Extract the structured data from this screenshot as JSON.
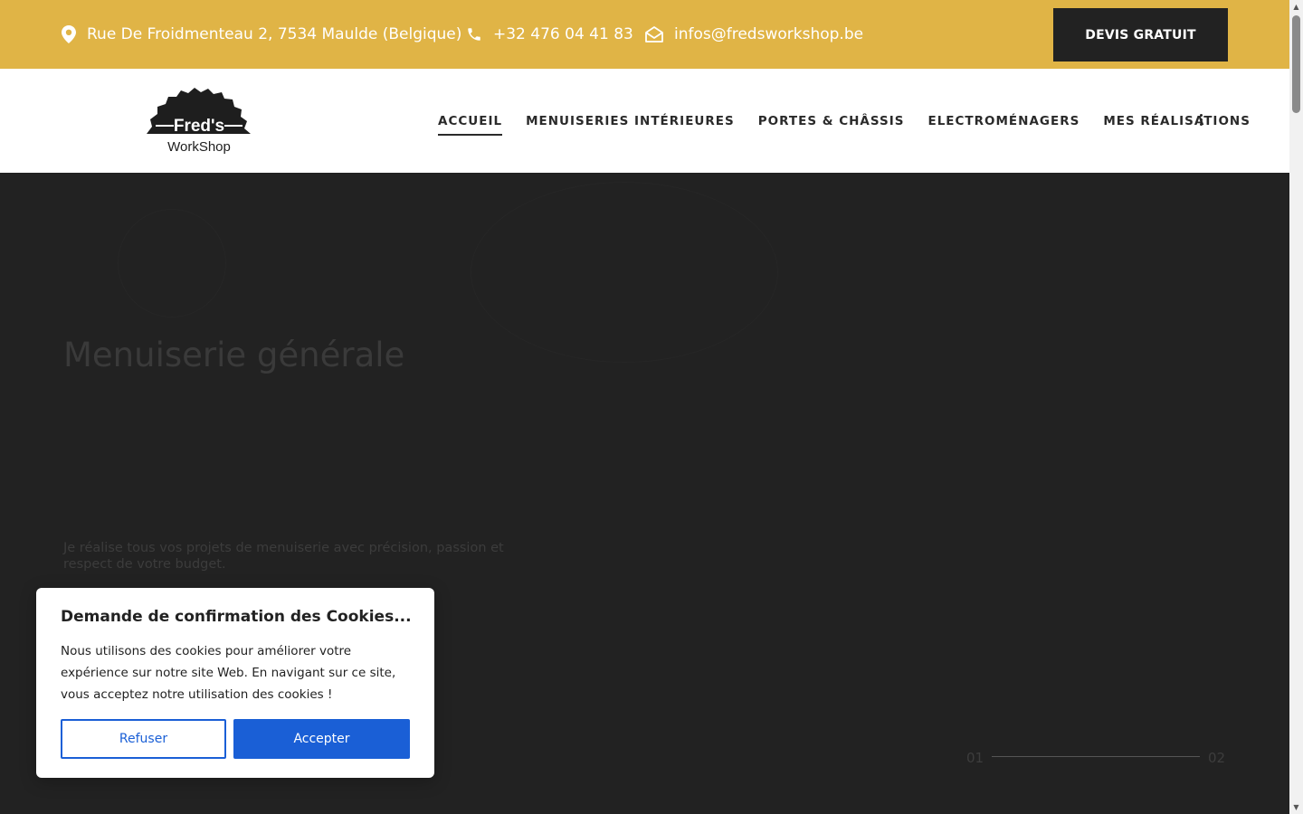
{
  "topbar": {
    "address": "Rue De Froidmenteau 2, 7534 Maulde (Belgique)",
    "phone": "+32 476 04 41 83",
    "email": "infos@fredsworkshop.be",
    "cta_label": "DEVIS GRATUIT",
    "background": "#e0b446"
  },
  "logo": {
    "name_line1": "Fred's",
    "name_line2": "WorkShop"
  },
  "nav": {
    "items": [
      {
        "label": "ACCUEIL",
        "active": true
      },
      {
        "label": "MENUISERIES INTÉRIEURES"
      },
      {
        "label": "PORTES & CHÂSSIS"
      },
      {
        "label": "ELECTROMÉNAGERS"
      },
      {
        "label": "MES RÉALISATIONS"
      }
    ],
    "more_icon": "more-vertical-icon"
  },
  "hero": {
    "title": "Menuiserie générale",
    "description": "Je réalise tous vos projets de menuiserie avec précision, passion et respect de votre budget.",
    "slide_current": "01",
    "slide_next": "02"
  },
  "cookie": {
    "title": "Demande de confirmation des Cookies...",
    "text": "Nous utilisons des cookies pour améliorer votre expérience sur notre site Web. En navigant sur ce site, vous acceptez notre utilisation des cookies !",
    "refuse_label": "Refuser",
    "accept_label": "Accepter",
    "accent": "#1a5fd6"
  }
}
